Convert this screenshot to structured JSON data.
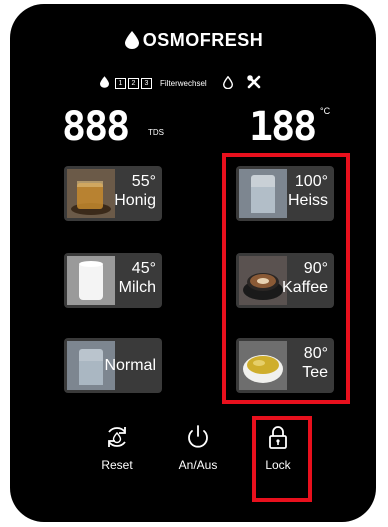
{
  "brand": {
    "name": "OSMOFRESH"
  },
  "status": {
    "filter_boxes": [
      "1",
      "2",
      "3"
    ],
    "filter_label": "Filterwechsel"
  },
  "display": {
    "tds_value": "888",
    "tds_unit": "TDS",
    "temp_value": "188",
    "temp_unit": "°C"
  },
  "presets": [
    {
      "temp": "55°",
      "label": "Honig"
    },
    {
      "temp": "45°",
      "label": "Milch"
    },
    {
      "temp": "",
      "label": "Normal"
    },
    {
      "temp": "100°",
      "label": "Heiss"
    },
    {
      "temp": "90°",
      "label": "Kaffee"
    },
    {
      "temp": "80°",
      "label": "Tee"
    }
  ],
  "controls": {
    "reset": "Reset",
    "power": "An/Aus",
    "lock": "Lock"
  },
  "colors": {
    "highlight": "#e8101d",
    "panel": "#000000",
    "button": "#3a3a3a"
  },
  "icons": [
    "water-drop-icon",
    "tools-icon",
    "reset-icon",
    "power-icon",
    "lock-icon"
  ]
}
